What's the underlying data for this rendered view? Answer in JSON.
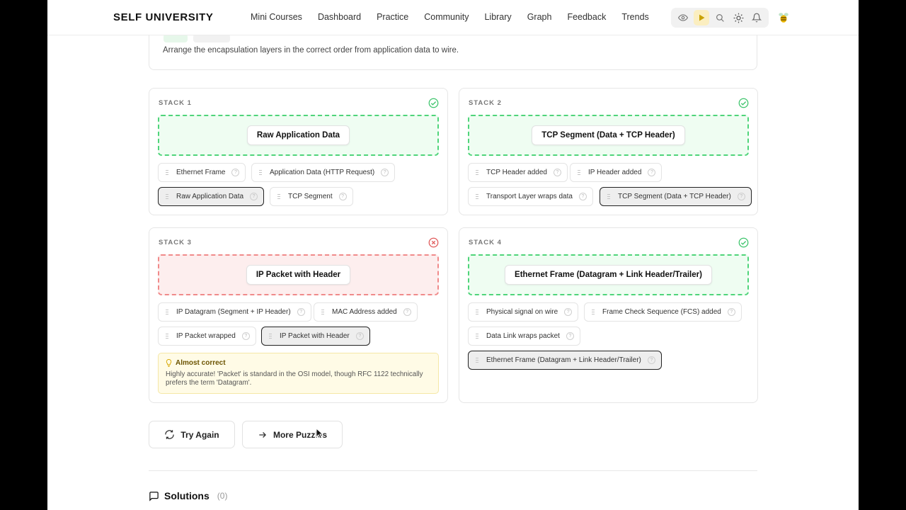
{
  "nav": {
    "brand": "SELF UNIVERSITY",
    "links": [
      "Mini Courses",
      "Dashboard",
      "Practice",
      "Community",
      "Library",
      "Graph",
      "Feedback",
      "Trends"
    ],
    "tools": [
      "eye-icon",
      "play-icon",
      "search-icon",
      "sun-icon",
      "bell-icon"
    ],
    "avatar_icon": "bee-avatar-icon"
  },
  "intro": {
    "instruction": "Arrange the encapsulation layers in the correct order from application data to wire."
  },
  "stacks": [
    {
      "title": "STACK 1",
      "status": "correct",
      "placed": "Raw Application Data",
      "options": [
        "Ethernet Frame",
        "Application Data (HTTP Request)",
        "Raw Application Data",
        "TCP Segment"
      ]
    },
    {
      "title": "STACK 2",
      "status": "correct",
      "placed": "TCP Segment (Data + TCP Header)",
      "options": [
        "TCP Header added",
        "IP Header added",
        "Transport Layer wraps data",
        "TCP Segment (Data + TCP Header)"
      ]
    },
    {
      "title": "STACK 3",
      "status": "incorrect",
      "placed": "IP Packet with Header",
      "options": [
        "IP Datagram (Segment + IP Header)",
        "MAC Address added",
        "IP Packet wrapped",
        "IP Packet with Header"
      ],
      "feedback": {
        "title": "Almost correct",
        "body": "Highly accurate! 'Packet' is standard in the OSI model, though RFC 1122 technically prefers the term 'Datagram'."
      }
    },
    {
      "title": "STACK 4",
      "status": "correct",
      "placed": "Ethernet Frame (Datagram + Link Header/Trailer)",
      "options": [
        "Physical signal on wire",
        "Frame Check Sequence (FCS) added",
        "Data Link wraps packet",
        "Ethernet Frame (Datagram + Link Header/Trailer)"
      ]
    }
  ],
  "actions": {
    "try_again": "Try Again",
    "more_puzzles": "More Puzzles"
  },
  "solutions": {
    "label": "Solutions",
    "count": "(0)"
  },
  "colors": {
    "correct": "#3cc46b",
    "incorrect": "#e05a5a",
    "accent_tool": "#fbeec0"
  }
}
